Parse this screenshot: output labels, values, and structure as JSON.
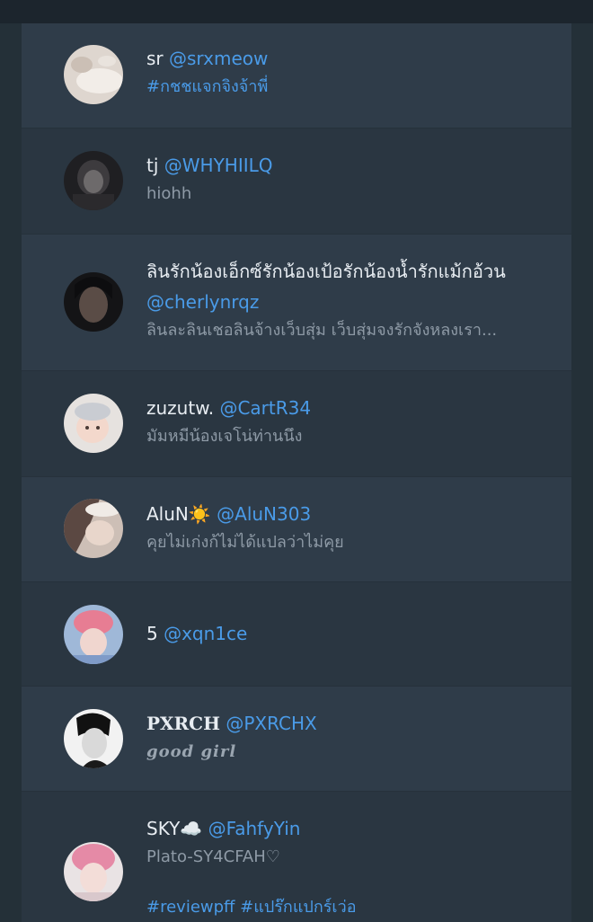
{
  "accounts": [
    {
      "name": "sr",
      "handle": "@srxmeow",
      "bio": [
        "#กชชแจกจิงจ้าพี่"
      ],
      "bio_style": "link"
    },
    {
      "name": "tj",
      "handle": "@WHYHIILQ",
      "bio": [
        "hiohh"
      ],
      "bio_style": "plain"
    },
    {
      "name": "ลินรักน้องเอ็กซ์รักน้องเป้อรักน้องน้ำรักแม้กอ้วน",
      "handle": "@cherlynrqz",
      "bio": [
        "ลินละลินเชอลินจ้างเว็บสุ่ม เว็บสุ่มจงรักจังหลงเรา..."
      ],
      "bio_style": "plain"
    },
    {
      "name": "zuzutw.",
      "handle": "@CartR34",
      "bio": [
        "มัมหมีน้องเจโน่ท่านนึง"
      ],
      "bio_style": "plain"
    },
    {
      "name": "AluN☀️",
      "handle": "@AluN303",
      "bio": [
        "คุยไม่เก่งก้ไม่ได้แปลว่าไม่คุย"
      ],
      "bio_style": "plain"
    },
    {
      "name": "5",
      "handle": "@xqn1ce",
      "bio": [],
      "bio_style": "plain"
    },
    {
      "name": "PXRCH",
      "handle": "@PXRCHX",
      "bio": [
        "good girl"
      ],
      "bio_style": "gothic"
    },
    {
      "name": "SKY☁️",
      "handle": "@FahfyYin",
      "bio": [
        "Plato-SY4CFAH♡",
        "",
        "#reviewpff #แปร๊กแปกร์เว่อ"
      ],
      "bio_style": "mixed"
    }
  ],
  "colors": {
    "background": "#243038",
    "row_a": "#2f3c49",
    "row_b": "#2a3641",
    "name": "#e8edf2",
    "handle": "#4a9be8",
    "bio": "#8e9aa6"
  }
}
